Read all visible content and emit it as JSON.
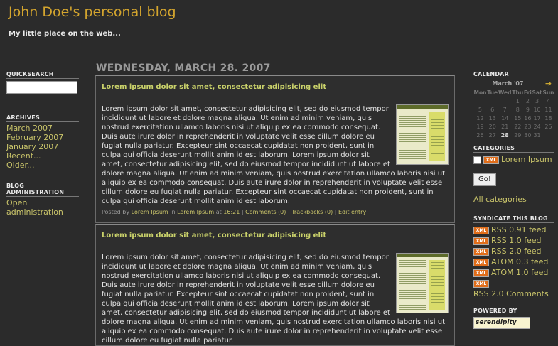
{
  "header": {
    "title": "John Doe's personal blog",
    "description": "My little place on the web..."
  },
  "left": {
    "quicksearch": {
      "heading": "QUICKSEARCH",
      "value": ""
    },
    "archives": {
      "heading": "ARCHIVES",
      "items": [
        "March 2007",
        "February 2007",
        "January 2007",
        "Recent...",
        "Older..."
      ]
    },
    "admin": {
      "heading": "BLOG ADMINISTRATION",
      "items": [
        "Open administration"
      ]
    }
  },
  "main": {
    "date": "WEDNESDAY, MARCH 28. 2007",
    "entries": [
      {
        "title": "Lorem ipsum dolor sit amet, consectetur adipisicing elit",
        "body": "Lorem ipsum dolor sit amet, consectetur adipisicing elit, sed do eiusmod tempor incididunt ut labore et dolore magna aliqua. Ut enim ad minim veniam, quis nostrud exercitation ullamco laboris nisi ut aliquip ex ea commodo consequat. Duis aute irure dolor in reprehenderit in voluptate velit esse cillum dolore eu fugiat nulla pariatur. Excepteur sint occaecat cupidatat non proident, sunt in culpa qui officia deserunt mollit anim id est laborum. Lorem ipsum dolor sit amet, consectetur adipisicing elit, sed do eiusmod tempor incididunt ut labore et dolore magna aliqua. Ut enim ad minim veniam, quis nostrud exercitation ullamco laboris nisi ut aliquip ex ea commodo consequat. Duis aute irure dolor in reprehenderit in voluptate velit esse cillum dolore eu fugiat nulla pariatur. Excepteur sint occaecat cupidatat non proident, sunt in culpa qui officia deserunt mollit anim id est laborum.",
        "footer": {
          "posted_by": "Posted by",
          "author": "Lorem Ipsum",
          "in": "in",
          "category": "Lorem Ipsum",
          "at": "at",
          "time": "16:21",
          "sep": "|",
          "comments": "Comments (0)",
          "trackbacks": "Trackbacks (0)",
          "edit": "Edit entry"
        }
      },
      {
        "title": "Lorem ipsum dolor sit amet, consectetur adipisicing elit",
        "body": "Lorem ipsum dolor sit amet, consectetur adipisicing elit, sed do eiusmod tempor incididunt ut labore et dolore magna aliqua. Ut enim ad minim veniam, quis nostrud exercitation ullamco laboris nisi ut aliquip ex ea commodo consequat. Duis aute irure dolor in reprehenderit in voluptate velit esse cillum dolore eu fugiat nulla pariatur. Excepteur sint occaecat cupidatat non proident, sunt in culpa qui officia deserunt mollit anim id est laborum. Lorem ipsum dolor sit amet, consectetur adipisicing elit, sed do eiusmod tempor incididunt ut labore et dolore magna aliqua. Ut enim ad minim veniam, quis nostrud exercitation ullamco laboris nisi ut aliquip ex ea commodo consequat. Duis aute irure dolor in reprehenderit in voluptate velit esse cillum dolore eu fugiat nulla pariatur."
      }
    ]
  },
  "right": {
    "calendar": {
      "heading": "CALENDAR",
      "month": "March '07",
      "next_icon": "arrow-right-icon",
      "days": [
        "Mon",
        "Tue",
        "Wed",
        "Thu",
        "Fri",
        "Sat",
        "Sun"
      ],
      "weeks": [
        [
          "",
          "",
          "",
          "1",
          "2",
          "3",
          "4"
        ],
        [
          "5",
          "6",
          "7",
          "8",
          "9",
          "10",
          "11"
        ],
        [
          "12",
          "13",
          "14",
          "15",
          "16",
          "17",
          "18"
        ],
        [
          "19",
          "20",
          "21",
          "22",
          "23",
          "24",
          "25"
        ],
        [
          "26",
          "27",
          "28",
          "29",
          "30",
          "31",
          ""
        ]
      ],
      "today": "28"
    },
    "categories": {
      "heading": "CATEGORIES",
      "items": [
        "Lorem Ipsum"
      ],
      "go_label": "Go!",
      "all_label": "All categories"
    },
    "syndicate": {
      "heading": "SYNDICATE THIS BLOG",
      "badge": "XML",
      "feeds": [
        "RSS 0.91 feed",
        "RSS 1.0 feed",
        "RSS 2.0 feed",
        "ATOM 0.3 feed",
        "ATOM 1.0 feed"
      ],
      "comments_feed": "RSS 2.0 Comments"
    },
    "powered": {
      "heading": "POWERED BY",
      "logo_text": "serendipity"
    }
  }
}
